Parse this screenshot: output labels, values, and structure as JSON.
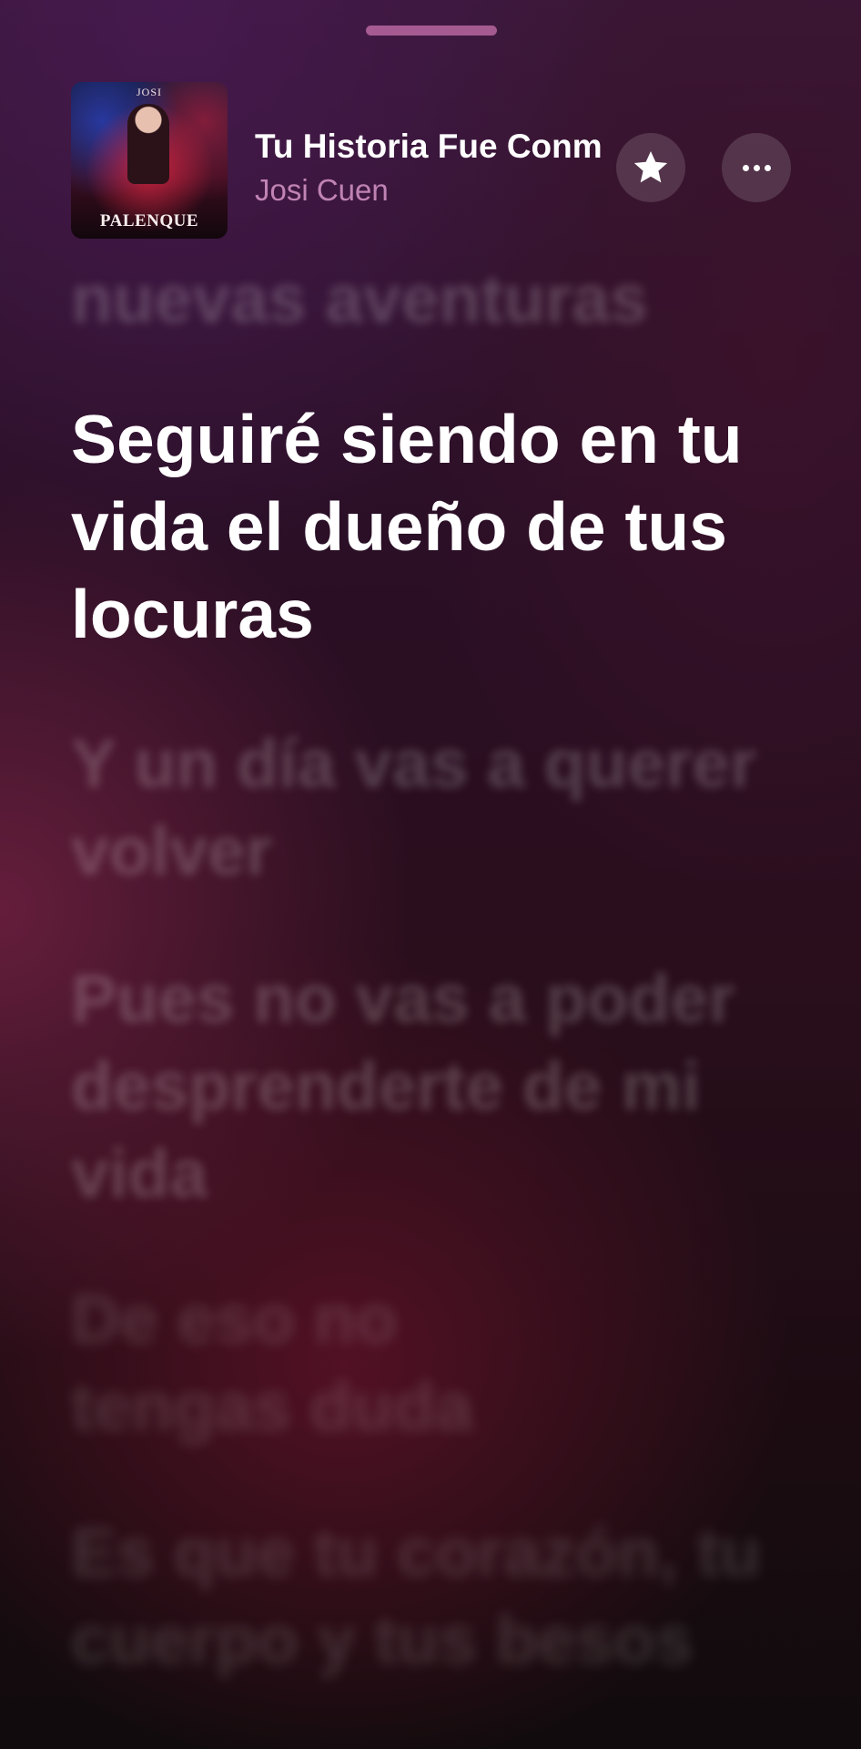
{
  "now_playing": {
    "title": "Tu Historia Fue Conmigo",
    "artist": "Josi Cuen",
    "artwork": {
      "top_text": "JOSI",
      "bottom_text": "PALENQUE"
    },
    "favorite_icon": "star-icon",
    "more_icon": "ellipsis-icon"
  },
  "lyrics": {
    "previous": "nuevas aventuras",
    "current": "Seguiré siendo en tu vida el dueño de tus locuras",
    "upcoming": [
      "Y un día vas a querer volver",
      "Pues no vas a poder desprenderte de mi vida",
      "De eso no tengas duda",
      "Es que tu corazón, tu cuerpo y tus besos"
    ]
  },
  "colors": {
    "background_top": "#3a1838",
    "background_bottom": "#110b0d",
    "artist_text": "#d796c8",
    "grabber": "#d278b4"
  }
}
